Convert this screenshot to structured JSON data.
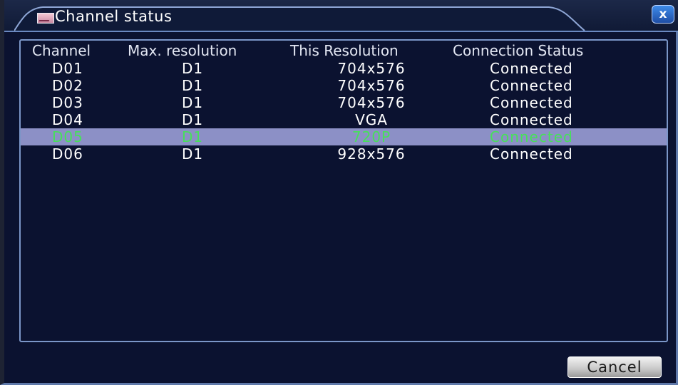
{
  "window": {
    "title": "Channel status",
    "close_label": "x"
  },
  "table": {
    "columns": [
      "Channel",
      "Max. resolution",
      "This Resolution",
      "Connection Status"
    ],
    "rows": [
      {
        "channel": "D01",
        "max_resolution": "D1",
        "this_resolution": "704x576",
        "status": "Connected",
        "selected": false
      },
      {
        "channel": "D02",
        "max_resolution": "D1",
        "this_resolution": "704x576",
        "status": "Connected",
        "selected": false
      },
      {
        "channel": "D03",
        "max_resolution": "D1",
        "this_resolution": "704x576",
        "status": "Connected",
        "selected": false
      },
      {
        "channel": "D04",
        "max_resolution": "D1",
        "this_resolution": "VGA",
        "status": "Connected",
        "selected": false
      },
      {
        "channel": "D05",
        "max_resolution": "D1",
        "this_resolution": "720P",
        "status": "Connected",
        "selected": true
      },
      {
        "channel": "D06",
        "max_resolution": "D1",
        "this_resolution": "928x576",
        "status": "Connected",
        "selected": false
      }
    ]
  },
  "footer": {
    "cancel_label": "Cancel"
  },
  "colors": {
    "background": "#0b1230",
    "border": "#7b96c8",
    "selected_row": "#8c90c6",
    "selected_text": "#47e05a"
  },
  "icons": {
    "title": "image-icon",
    "close": "close-icon"
  }
}
